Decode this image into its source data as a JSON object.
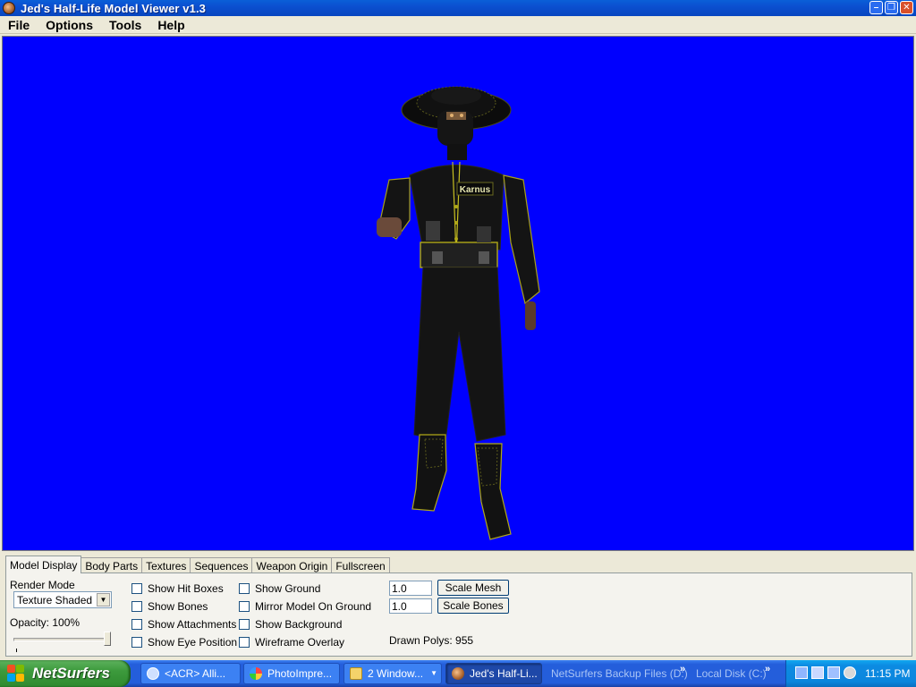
{
  "window": {
    "title": "Jed's Half-Life Model Viewer v1.3",
    "controls": [
      "minimize",
      "maximize",
      "close"
    ]
  },
  "menu": [
    "File",
    "Options",
    "Tools",
    "Help"
  ],
  "viewport": {
    "background_color": "#0000fe",
    "model_name_tag": "Karnus"
  },
  "tabs": [
    "Model Display",
    "Body Parts",
    "Textures",
    "Sequences",
    "Weapon Origin",
    "Fullscreen"
  ],
  "active_tab": "Model Display",
  "model_display": {
    "render_mode_label": "Render Mode",
    "render_mode_value": "Texture Shaded",
    "opacity_label": "Opacity: 100%",
    "opacity_fraction": 1.0,
    "checkboxes_col1": [
      {
        "label": "Show Hit Boxes",
        "checked": false
      },
      {
        "label": "Show Bones",
        "checked": false
      },
      {
        "label": "Show Attachments",
        "checked": false
      },
      {
        "label": "Show Eye Position",
        "checked": false
      }
    ],
    "checkboxes_col2": [
      {
        "label": "Show Ground",
        "checked": false
      },
      {
        "label": "Mirror Model On Ground",
        "checked": false
      },
      {
        "label": "Show Background",
        "checked": false
      },
      {
        "label": "Wireframe Overlay",
        "checked": false
      }
    ],
    "scale_mesh_value": "1.0",
    "scale_mesh_button": "Scale Mesh",
    "scale_bones_value": "1.0",
    "scale_bones_button": "Scale Bones",
    "drawn_polys": "Drawn Polys: 955"
  },
  "taskbar": {
    "start_label": "NetSurfers",
    "tasks": [
      {
        "label": "<ACR> Alli...",
        "icon": "chat-icon"
      },
      {
        "label": "PhotoImpre...",
        "icon": "photo-icon"
      },
      {
        "label": "2 Window...",
        "icon": "folder-icon"
      },
      {
        "label": "Jed's Half-Li...",
        "icon": "app-icon",
        "active": true
      }
    ],
    "links": [
      "NetSurfers Backup Files (D:)",
      "Local Disk (C:)"
    ],
    "clock": "11:15 PM"
  }
}
